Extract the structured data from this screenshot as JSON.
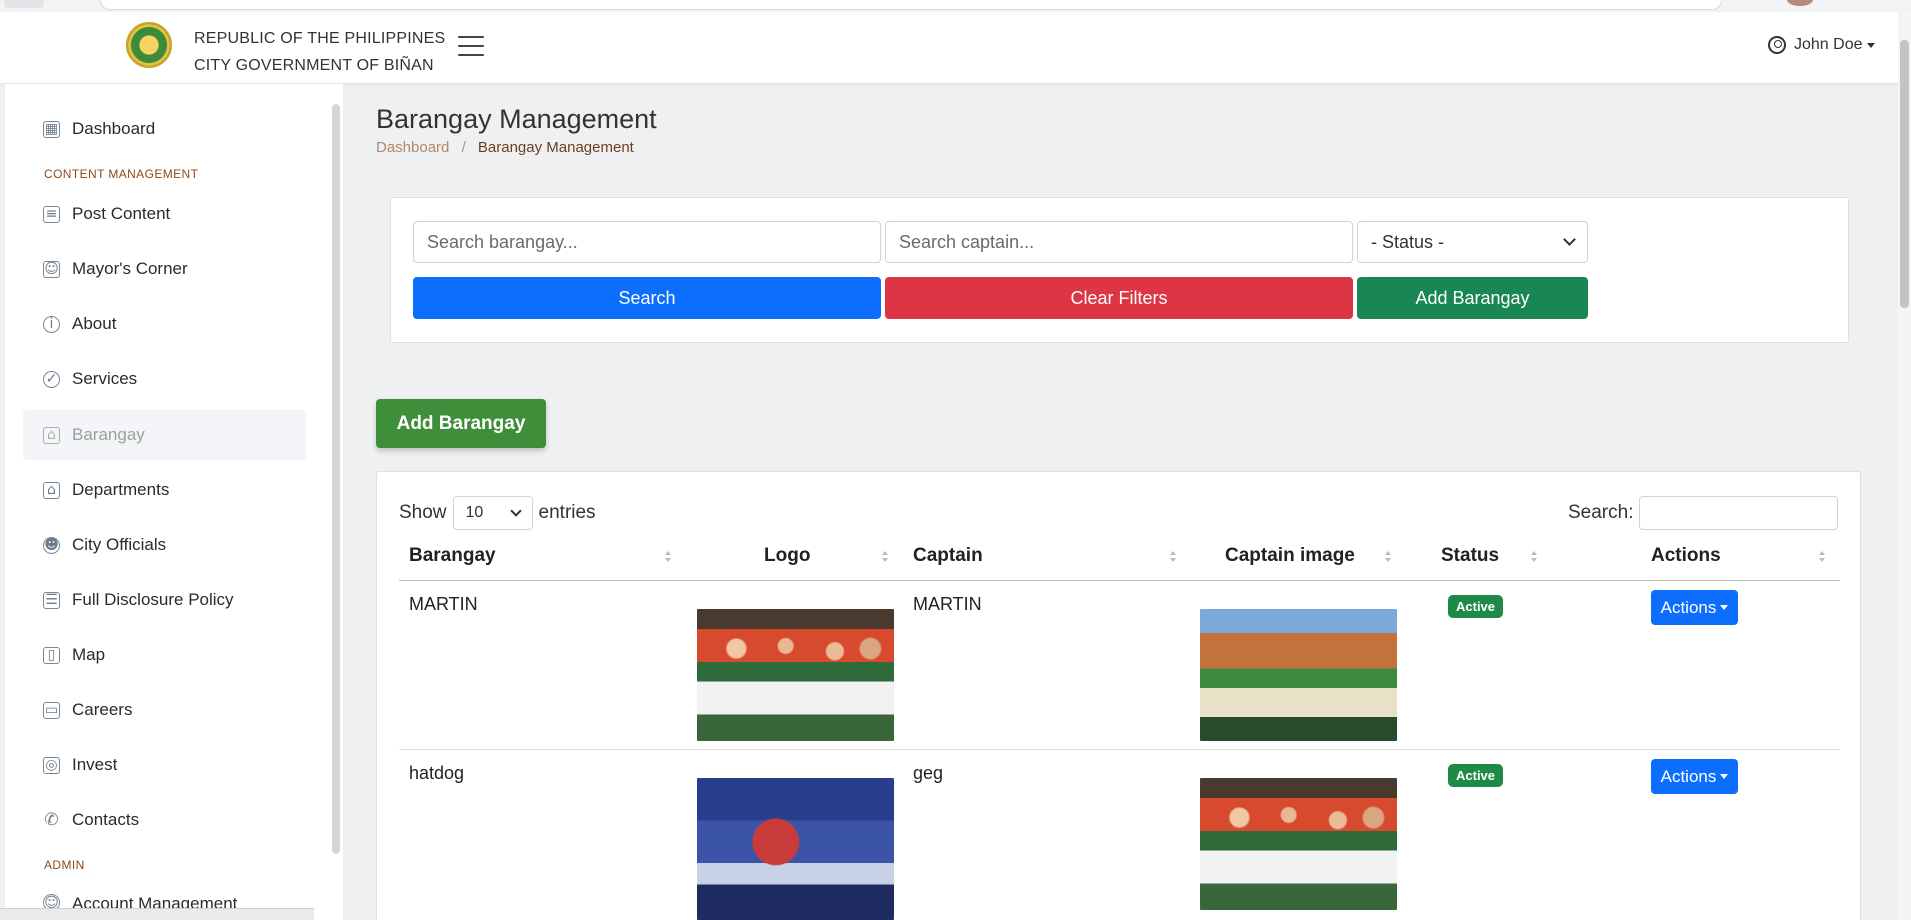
{
  "header": {
    "seal_title_line1": "REPUBLIC OF THE PHILIPPINES",
    "seal_title_line2": "CITY GOVERNMENT OF BIÑAN",
    "user_name": "John Doe"
  },
  "sidebar": {
    "items": [
      {
        "label": "Dashboard",
        "icon": "grid-icon"
      },
      {
        "label": "Post Content",
        "icon": "newspaper-icon"
      },
      {
        "label": "Mayor's Corner",
        "icon": "person-badge-icon"
      },
      {
        "label": "About",
        "icon": "info-circle-icon"
      },
      {
        "label": "Services",
        "icon": "check-circle-icon"
      },
      {
        "label": "Barangay",
        "icon": "house-icon",
        "active": true
      },
      {
        "label": "Departments",
        "icon": "bank-icon"
      },
      {
        "label": "City Officials",
        "icon": "people-icon"
      },
      {
        "label": "Full Disclosure Policy",
        "icon": "list-icon"
      },
      {
        "label": "Map",
        "icon": "map-icon"
      },
      {
        "label": "Careers",
        "icon": "briefcase-icon"
      },
      {
        "label": "Invest",
        "icon": "cash-icon"
      },
      {
        "label": "Contacts",
        "icon": "telephone-icon"
      },
      {
        "label": "Account Management",
        "icon": "person-gear-icon"
      }
    ],
    "sections": {
      "content": "CONTENT MANAGEMENT",
      "admin": "ADMIN"
    }
  },
  "page": {
    "title": "Barangay Management",
    "breadcrumb": {
      "home": "Dashboard",
      "separator": "/",
      "current": "Barangay Management"
    }
  },
  "filters": {
    "barangay_placeholder": "Search barangay...",
    "captain_placeholder": "Search captain...",
    "status_selected": "- Status -",
    "search_label": "Search",
    "clear_label": "Clear Filters",
    "add_label": "Add Barangay"
  },
  "add_button": "Add Barangay",
  "table": {
    "show_label": "Show",
    "entries_value": "10",
    "entries_label": "entries",
    "search_label": "Search:",
    "columns": [
      "Barangay",
      "Logo",
      "Captain",
      "Captain image",
      "Status",
      "Actions"
    ],
    "rows": [
      {
        "barangay": "MARTIN",
        "captain": "MARTIN",
        "status": "Active",
        "action": "Actions"
      },
      {
        "barangay": "hatdog",
        "captain": "geg",
        "status": "Active",
        "action": "Actions"
      }
    ]
  },
  "colors": {
    "primary": "#0d6efd",
    "danger": "#dc3545",
    "success": "#198754",
    "add_green": "#3f8e3a",
    "badge_green": "#1e8a48"
  }
}
